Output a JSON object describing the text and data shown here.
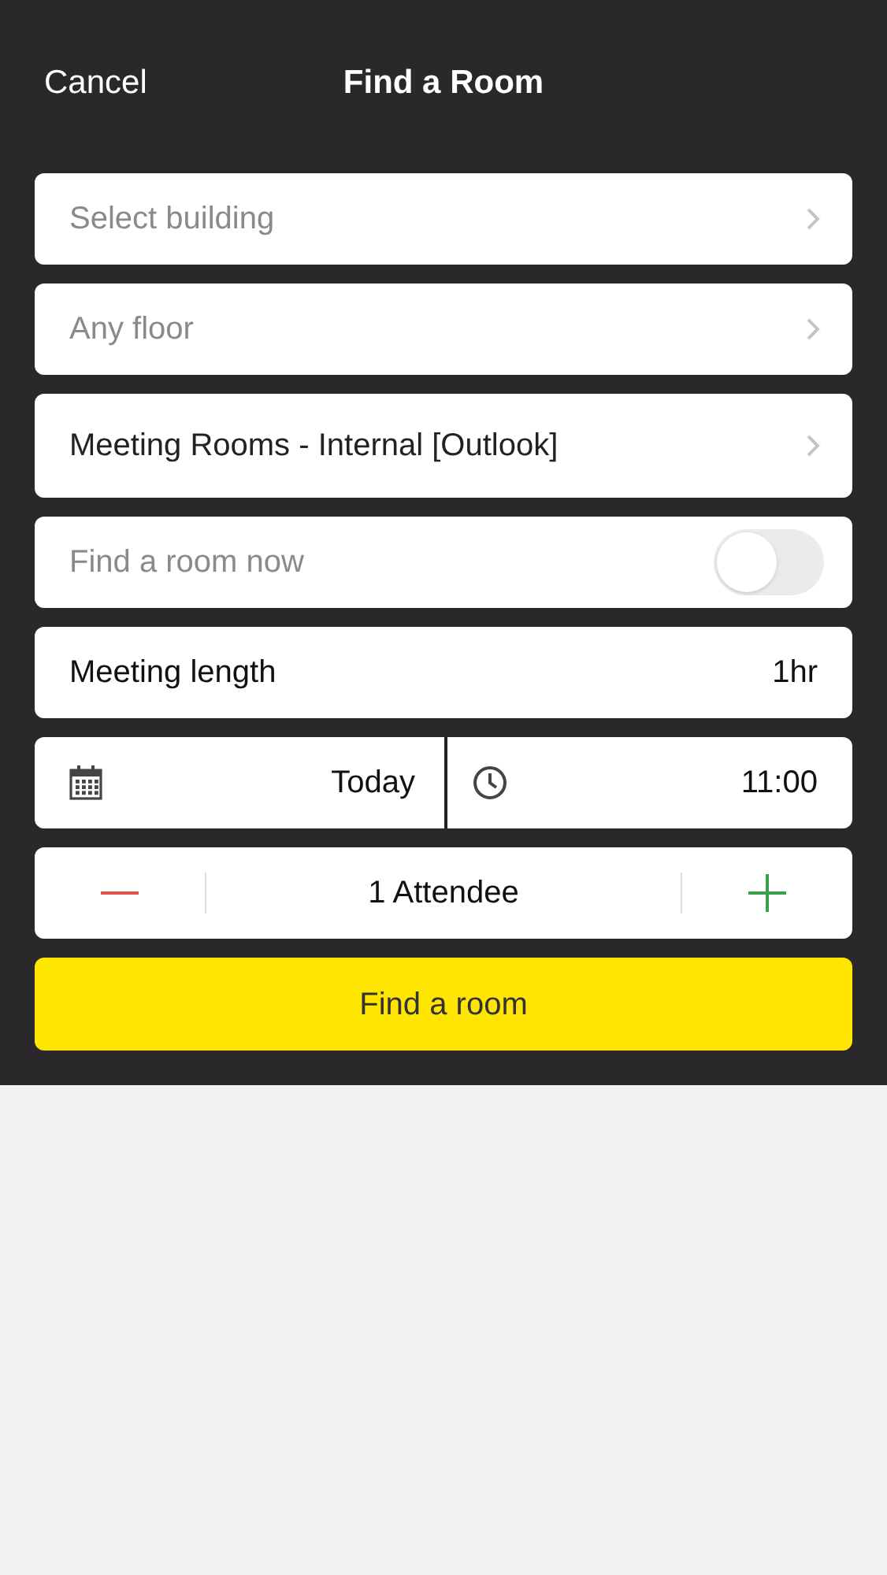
{
  "header": {
    "cancel": "Cancel",
    "title": "Find a Room"
  },
  "pickers": [
    {
      "placeholder": "Select building"
    },
    {
      "placeholder": "Any floor"
    },
    {
      "value": "Meeting Rooms - Internal [Outlook]"
    }
  ],
  "find_now": {
    "label": "Find a room now",
    "on": false
  },
  "meeting_length": {
    "label": "Meeting length",
    "value": "1hr"
  },
  "date": "Today",
  "time": "11:00",
  "attendees": "1 Attendee",
  "submit": "Find a room"
}
